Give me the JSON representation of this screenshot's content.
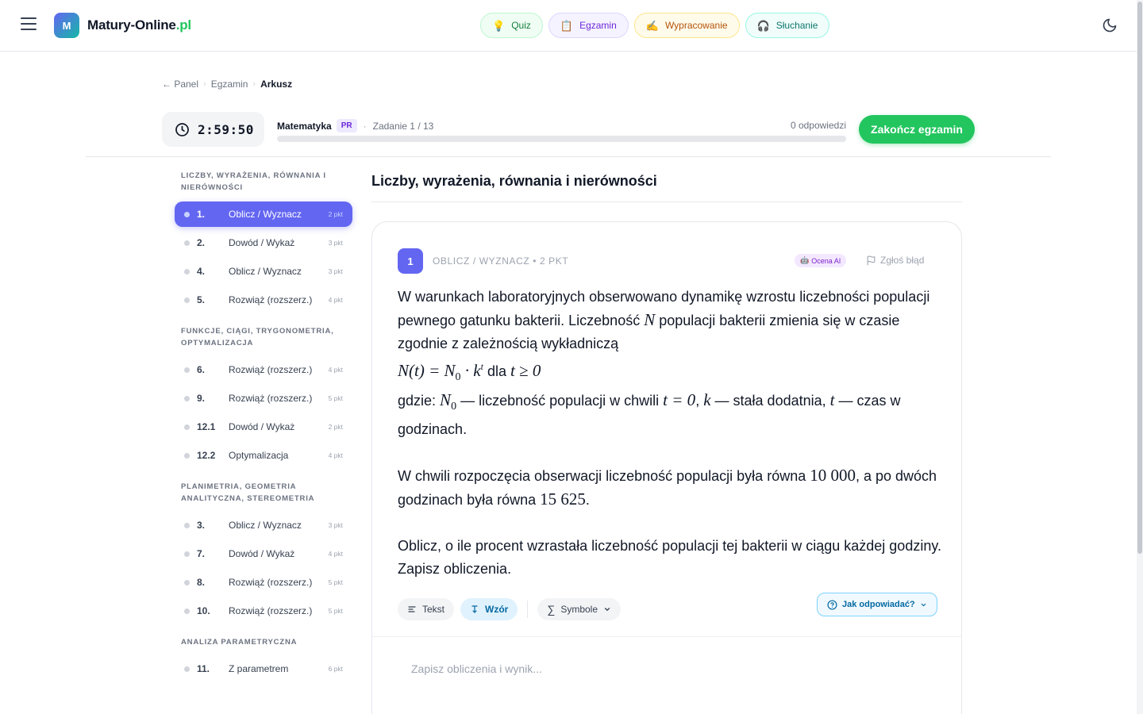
{
  "brand": {
    "logo_letter": "M",
    "name": "Matury-Online",
    "tld": ".pl"
  },
  "modes": [
    {
      "label": "Quiz",
      "icon": "💡"
    },
    {
      "label": "Egzamin",
      "icon": "📋"
    },
    {
      "label": "Wypracowanie",
      "icon": "✍️"
    },
    {
      "label": "Słuchanie",
      "icon": "🎧"
    }
  ],
  "breadcrumb": {
    "back": "← Panel",
    "middle": "Egzamin",
    "current": "Arkusz"
  },
  "exam": {
    "timer": "2:59:50",
    "subject": "Matematyka",
    "level": "PR",
    "task_progress": "Zadanie 1 / 13",
    "answers_count": "0 odpowiedzi",
    "progress_fraction": 0,
    "finish_label": "Zakończ egzamin"
  },
  "sidebar": {
    "sections": [
      {
        "title": "Liczby, wyrażenia, równania i nierówności",
        "tasks": [
          {
            "num": "1.",
            "label": "Oblicz / Wyznacz",
            "pts": "2 pkt",
            "active": true
          },
          {
            "num": "2.",
            "label": "Dowód / Wykaż",
            "pts": "3 pkt"
          },
          {
            "num": "4.",
            "label": "Oblicz / Wyznacz",
            "pts": "3 pkt"
          },
          {
            "num": "5.",
            "label": "Rozwiąż (rozszerz.)",
            "pts": "4 pkt"
          }
        ]
      },
      {
        "title": "Funkcje, ciągi, trygonometria, optymalizacja",
        "tasks": [
          {
            "num": "6.",
            "label": "Rozwiąż (rozszerz.)",
            "pts": "4 pkt"
          },
          {
            "num": "9.",
            "label": "Rozwiąż (rozszerz.)",
            "pts": "5 pkt"
          },
          {
            "num": "12.1",
            "label": "Dowód / Wykaż",
            "pts": "2 pkt"
          },
          {
            "num": "12.2",
            "label": "Optymalizacja",
            "pts": "4 pkt"
          }
        ]
      },
      {
        "title": "Planimetria, geometria analityczna, stereometria",
        "tasks": [
          {
            "num": "3.",
            "label": "Oblicz / Wyznacz",
            "pts": "3 pkt"
          },
          {
            "num": "7.",
            "label": "Dowód / Wykaż",
            "pts": "4 pkt"
          },
          {
            "num": "8.",
            "label": "Rozwiąż (rozszerz.)",
            "pts": "5 pkt"
          },
          {
            "num": "10.",
            "label": "Rozwiąż (rozszerz.)",
            "pts": "5 pkt"
          }
        ]
      },
      {
        "title": "Analiza parametryczna",
        "tasks": [
          {
            "num": "11.",
            "label": "Z parametrem",
            "pts": "6 pkt"
          }
        ]
      }
    ]
  },
  "main": {
    "section_heading": "Liczby, wyrażenia, równania i nierówności",
    "question": {
      "number": "1",
      "meta": "Oblicz / Wyznacz • 2 pkt",
      "ai_badge": "Ocena AI",
      "report_label": "Zgłoś błąd",
      "p1_a": "W warunkach laboratoryjnych obserwowano dynamikę wzrostu liczebności populacji pewnego gatunku bakterii. Liczebność ",
      "p1_var_N": "N",
      "p1_b": " populacji bakterii zmienia się w czasie zgodnie z zależnością wykładniczą",
      "formula_lhs": "N(t) = N",
      "formula_sub0": "0",
      "formula_dot": " · k",
      "formula_sup_t": "t",
      "formula_dla": " dla ",
      "formula_cond": "t ≥ 0",
      "where_a": "gdzie: ",
      "where_N0": "N",
      "where_N0_sub": "0",
      "where_b": " — liczebność populacji w chwili ",
      "where_t0": "t = 0",
      "where_c": ", ",
      "where_k": "k",
      "where_d": " — stała dodatnia, ",
      "where_t": "t",
      "where_e": " — czas w godzinach.",
      "p2_a": "W chwili rozpoczęcia obserwacji liczebność populacji była równa ",
      "p2_v1": "10 000",
      "p2_b": ", a po dwóch godzinach była równa ",
      "p2_v2": "15 625",
      "p2_c": ".",
      "p3": "Oblicz, o ile procent wzrastała liczebność populacji tej bakterii w ciągu każdej godziny. Zapisz obliczenia."
    },
    "toolbar": {
      "text_label": "Tekst",
      "formula_label": "Wzór",
      "symbols_label": "Symbole",
      "howto_label": "Jak odpowiadać?"
    },
    "answer": {
      "placeholder": "Zapisz obliczenia i wynik..."
    }
  },
  "colors": {
    "accent": "#6366f1",
    "success": "#22c55e"
  }
}
